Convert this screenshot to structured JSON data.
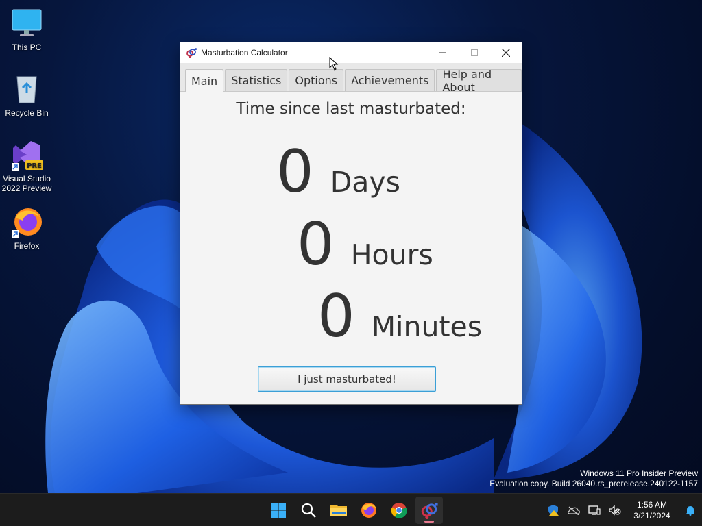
{
  "desktop": {
    "icons": [
      {
        "label": "This PC",
        "icon": "monitor-icon"
      },
      {
        "label": "Recycle Bin",
        "icon": "recycle-bin-icon"
      },
      {
        "label": "Visual Studio\n2022 Preview",
        "label_line1": "Visual Studio",
        "label_line2": "2022 Preview",
        "icon": "visual-studio-icon",
        "badge": "PRE"
      },
      {
        "label": "Firefox",
        "icon": "firefox-icon"
      }
    ]
  },
  "watermark": {
    "line1": "Windows 11 Pro Insider Preview",
    "line2": "Evaluation copy. Build 26040.rs_prerelease.240122-1157"
  },
  "window": {
    "title": "Masturbation Calculator",
    "tabs": [
      {
        "label": "Main",
        "selected": true
      },
      {
        "label": "Statistics",
        "selected": false
      },
      {
        "label": "Options",
        "selected": false
      },
      {
        "label": "Achievements",
        "selected": false
      },
      {
        "label": "Help and About",
        "selected": false
      }
    ],
    "heading": "Time since last masturbated:",
    "days": {
      "value": "0",
      "unit": "Days"
    },
    "hours": {
      "value": "0",
      "unit": "Hours"
    },
    "minutes": {
      "value": "0",
      "unit": "Minutes"
    },
    "action_label": "I just masturbated!"
  },
  "taskbar": {
    "apps": [
      "windows-start-icon",
      "search-icon",
      "file-explorer-icon",
      "firefox-icon",
      "chrome-icon",
      "masturbation-calculator-icon"
    ],
    "clock": {
      "time": "1:56 AM",
      "date": "3/21/2024"
    },
    "tray": [
      "security-shield-icon",
      "onedrive-icon",
      "network-icon",
      "volume-muted-icon",
      "notification-bell-icon"
    ]
  },
  "colors": {
    "accent": "#3b9fd6",
    "taskbar": "#1c1c1c",
    "window_bg": "#f4f4f4"
  }
}
